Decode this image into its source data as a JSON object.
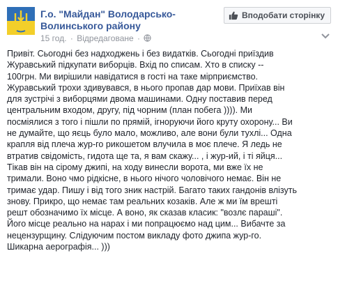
{
  "post": {
    "page_name_line1": "Г.о. \"Майдан\" Володарсько-",
    "page_name_line2": "Волинського району",
    "time": "15 год.",
    "edited": "Відредаговане",
    "like_page_label": "Вподобати сторінку",
    "icons": {
      "thumb": "thumbs-up-icon",
      "audience": "globe-icon",
      "menu": "chevron-down-icon"
    },
    "body_lines": [
      "Привіт. Сьогодні без надходжень і без видатків. Сьогодні приїздив",
      "Журавський підкупати виборців. Вхід по списам. Хто в списку --",
      "100грн. Ми вирішили навідатися в гості на таке мірприємство.",
      "Журавський трохи здивувався, в нього пропав дар мови. Приїхав він",
      "для зустрічі з виборцями двома машинами. Одну поставив перед",
      "центральним входом, другу, під чорним (план побега )))). Ми",
      "посміялися з того і пішли по прямій, ігноруючи його круту охорону... Ви",
      "не думайте, що яєць було мало, можливо, але вони були тухлі... Одна",
      "крапля від плеча жур-го рикошетом влучила в моє плече. Я ледь не",
      "втратив свідомість, гидота ще та, я вам скажу... , і жур-ий, і ті яйця...",
      "Тікав він на сірому джипі, на ходу винесли ворота, ми вже їх не",
      "тримали. Воно чмо рідкісне, в нього нічого чоловічого немає. Він не",
      "тримає удар. Пишу і від того зник настрій. Багато таких гандонів влізуть",
      "знову. Прикро, що немає там реальних козаків. Але ж ми їм врешті",
      "решт обозначимо їх місце. А воно, як сказав класик: \"возлє параші\".",
      "Його місце реально на нарах і ми попрацюємо над цим... Вибачте за",
      "нецензурщину. Слідуючим постом викладу фото джипа жур-го.",
      "Шикарна аерографія... )))"
    ]
  }
}
